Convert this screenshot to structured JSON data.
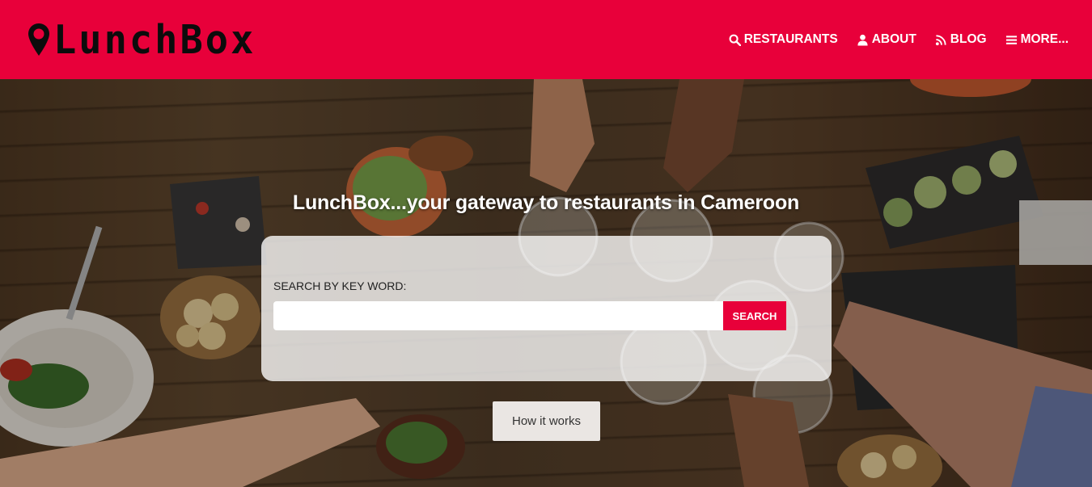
{
  "brand": {
    "name": "LunchBox",
    "accent_color": "#e8003a",
    "icon": "map-pin-icon"
  },
  "nav": {
    "items": [
      {
        "label": "RESTAURANTS",
        "icon": "search-icon"
      },
      {
        "label": "ABOUT",
        "icon": "user-icon"
      },
      {
        "label": "BLOG",
        "icon": "rss-icon"
      },
      {
        "label": "MORE...",
        "icon": "menu-icon"
      }
    ]
  },
  "hero": {
    "tagline": "LunchBox...your gateway to restaurants in Cameroon",
    "search": {
      "label": "SEARCH BY KEY WORD:",
      "value": "",
      "placeholder": "",
      "button_label": "SEARCH"
    },
    "how_it_works_label": "How it works"
  }
}
